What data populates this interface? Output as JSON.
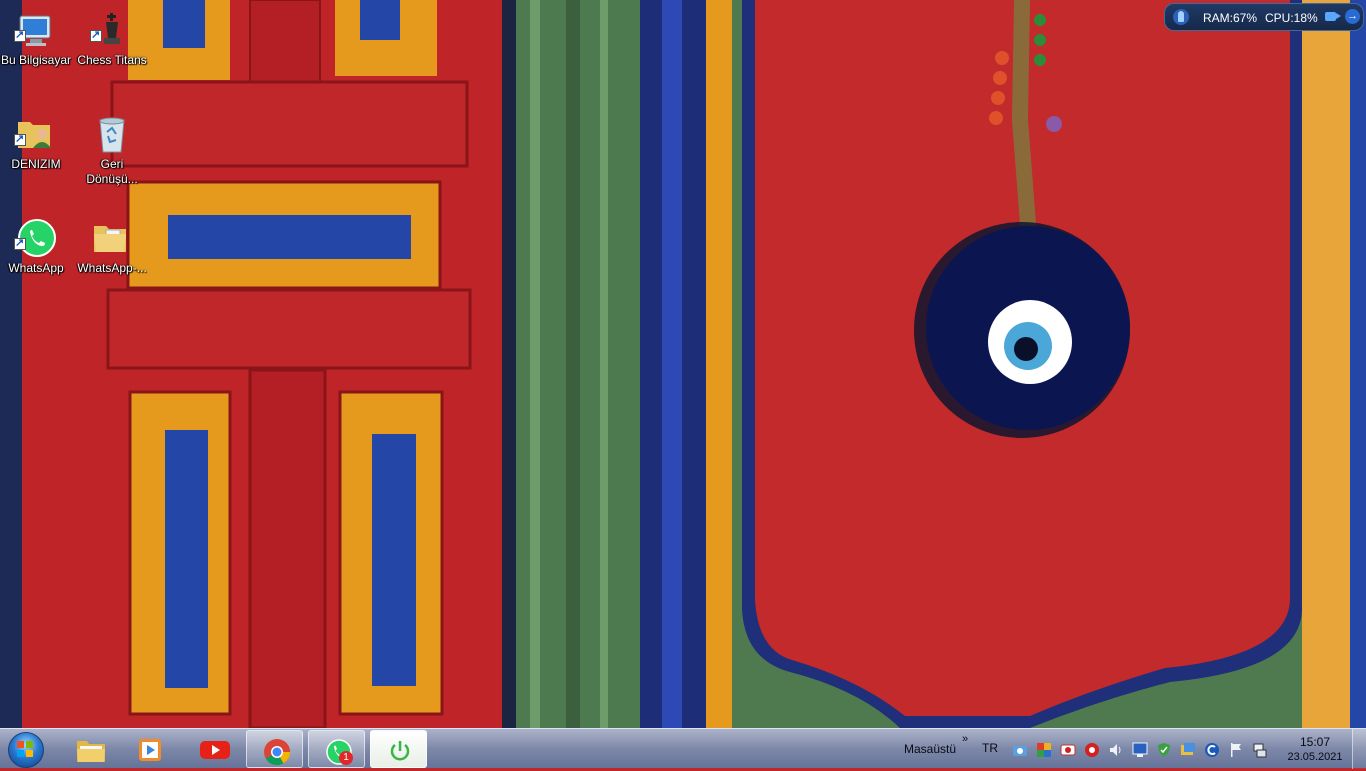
{
  "desktop": {
    "icons": [
      {
        "label": "Bu Bilgisayar"
      },
      {
        "label": "Chess Titans"
      },
      {
        "label": "DENIZIM"
      },
      {
        "label": "Geri Dönüşü..."
      },
      {
        "label": "WhatsApp"
      },
      {
        "label": "WhatsApp-..."
      }
    ]
  },
  "widget": {
    "ram_label": "RAM:67%",
    "cpu_label": "CPU:18%"
  },
  "taskbar": {
    "pinned": [
      {
        "icon": "file-explorer-icon"
      },
      {
        "icon": "media-player-icon"
      },
      {
        "icon": "youtube-icon"
      },
      {
        "icon": "chrome-icon"
      },
      {
        "icon": "whatsapp-icon",
        "badge": "1"
      },
      {
        "icon": "power-app-icon"
      }
    ],
    "desktop_toolbar_label": "Masaüstü",
    "overflow_chevron": "»",
    "language": "TR",
    "clock": {
      "time": "15:07",
      "date": "23.05.2021"
    }
  },
  "colors": {
    "door_red": "#c0262a",
    "panel_orange": "#e99a1e",
    "panel_blue": "#2648a8",
    "post_green": "#4f7a52",
    "whatsapp_green": "#25d366"
  }
}
